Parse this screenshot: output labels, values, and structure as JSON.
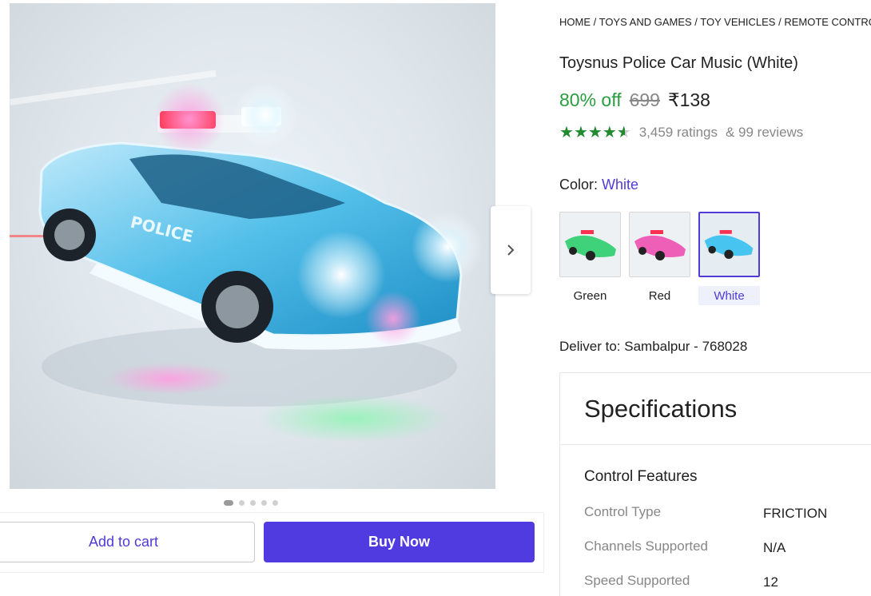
{
  "breadcrumb": [
    "HOME",
    "TOYS AND GAMES",
    "TOY VEHICLES",
    "REMOTE CONTROL"
  ],
  "product": {
    "title": "Toysnus Police Car Music (White)",
    "discount": "80% off",
    "mrp": "699",
    "price": "₹138",
    "rating_stars": 4.5,
    "ratings": "3,459 ratings",
    "reviews": "& 99 reviews",
    "hero_image_text": "POLICE"
  },
  "color": {
    "label": "Color:",
    "selected": "White",
    "options": [
      {
        "name": "Green",
        "tint": "#3fd27a"
      },
      {
        "name": "Red",
        "tint": "#ee5fb8"
      },
      {
        "name": "White",
        "tint": "#48c4f0"
      }
    ]
  },
  "delivery": {
    "text": "Deliver to:  Sambalpur - 768028"
  },
  "actions": {
    "add_to_cart": "Add to cart",
    "buy_now": "Buy Now"
  },
  "gallery": {
    "total_dots": 5,
    "active_dot": 1
  },
  "specifications": {
    "heading": "Specifications",
    "section": "Control Features",
    "rows": [
      {
        "label": "Control Type",
        "value": "FRICTION"
      },
      {
        "label": "Channels Supported",
        "value": "N/A"
      },
      {
        "label": "Speed Supported",
        "value": "12"
      }
    ]
  },
  "colors": {
    "accent": "#4f3bd6",
    "discount_green": "#2a9d3f",
    "star_green": "#1f8a2e"
  }
}
